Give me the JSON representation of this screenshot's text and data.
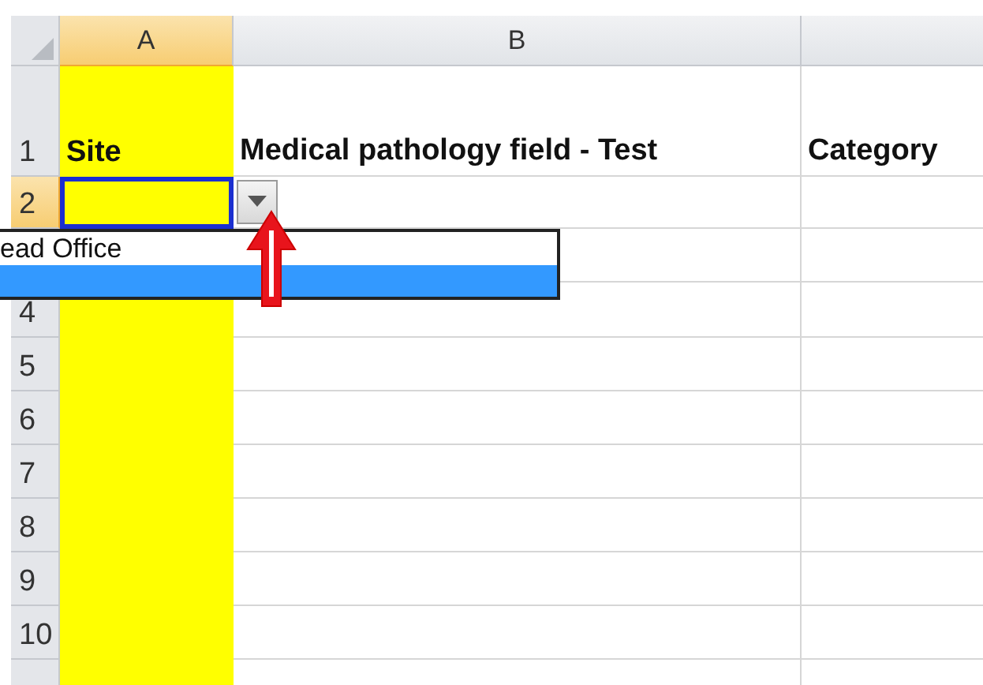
{
  "columns": [
    {
      "label": "A",
      "selected": true,
      "color": "#ffff00"
    },
    {
      "label": "B",
      "selected": false,
      "color": "#ffffff"
    }
  ],
  "rows": [
    {
      "header": "1",
      "selected": false,
      "cells": [
        "Site",
        "Medical pathology field - Test",
        "Category"
      ]
    },
    {
      "header": "2",
      "selected": true,
      "active_cell": true
    },
    {},
    {
      "header": "4",
      "selected": false
    },
    {
      "header": "5",
      "selected": false
    },
    {
      "header": "6",
      "selected": false
    },
    {
      "header": "7",
      "selected": false
    },
    {
      "header": "8",
      "selected": false
    },
    {
      "header": "9",
      "selected": false
    },
    {
      "header": "10",
      "selected": false
    },
    {}
  ],
  "dropdown": {
    "items": [
      {
        "label": "ead Office",
        "selected": false
      },
      {
        "selected": true
      }
    ]
  }
}
